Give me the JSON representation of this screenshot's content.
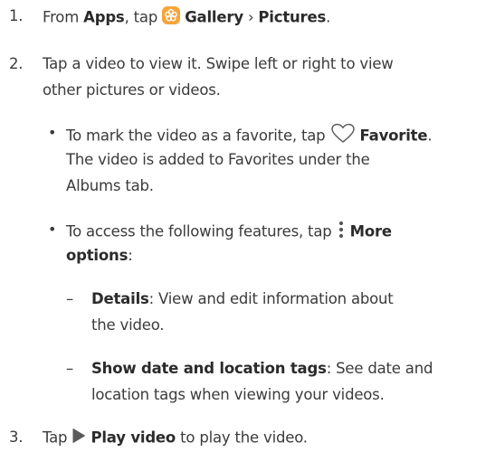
{
  "step1": {
    "number": "1.",
    "from": "From",
    "apps": "Apps",
    "tap": ", tap",
    "gallery": "Gallery",
    "sep": "›",
    "pictures": "Pictures",
    "end": "."
  },
  "step2": {
    "number": "2.",
    "line1": "Tap a video to view it. Swipe left or right to view",
    "line2": "other pictures or videos."
  },
  "bullet1": {
    "marker": "•",
    "pre": "To mark the video as a favorite, tap",
    "favorite": "Favorite",
    "end": ".",
    "line2": "The video is added to Favorites under the",
    "line3": "Albums tab."
  },
  "bullet2": {
    "marker": "•",
    "pre": "To access the following features, tap",
    "more": "More",
    "options": "options",
    "colon": ":"
  },
  "sub1": {
    "marker": "–",
    "title": "Details",
    "text": ": View and edit information about",
    "line2": "the video."
  },
  "sub2": {
    "marker": "–",
    "title": "Show date and location tags",
    "text": ": See date and",
    "line2": "location tags when viewing your videos."
  },
  "step3": {
    "number": "3.",
    "tap": "Tap",
    "play": "Play video",
    "end": "to play the video."
  },
  "icons": {
    "gallery": "gallery-flower-icon",
    "favorite": "heart-outline-icon",
    "more": "more-options-icon",
    "play": "play-icon"
  },
  "colors": {
    "gallery_icon": "#f6a43a",
    "text": "#3b3b3b"
  }
}
